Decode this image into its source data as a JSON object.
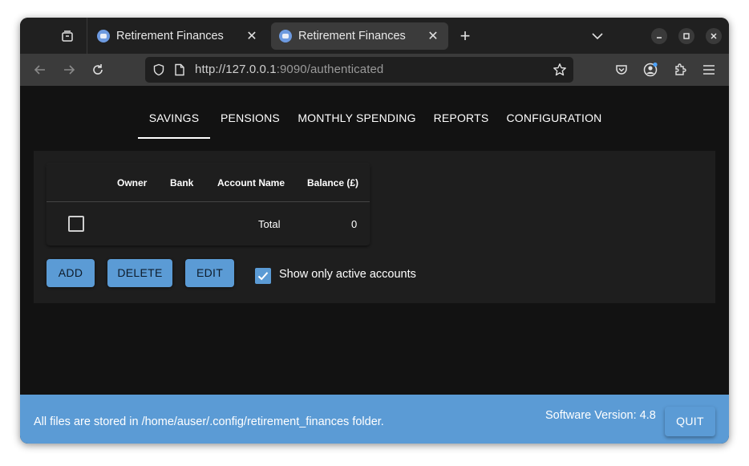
{
  "browser": {
    "tabs": [
      {
        "title": "Retirement Finances",
        "active": false
      },
      {
        "title": "Retirement Finances",
        "active": true
      }
    ],
    "url_host": "http://127.0.0.1",
    "url_rest": ":9090/authenticated"
  },
  "app": {
    "nav_tabs": [
      "SAVINGS",
      "PENSIONS",
      "MONTHLY SPENDING",
      "REPORTS",
      "CONFIGURATION"
    ],
    "selected_tab": "SAVINGS",
    "table": {
      "headers": [
        "Owner",
        "Bank",
        "Account Name",
        "Balance (£)"
      ],
      "total_label": "Total",
      "total_value": "0"
    },
    "buttons": {
      "add": "ADD",
      "delete": "DELETE",
      "edit": "EDIT"
    },
    "show_active_label": "Show only active accounts",
    "show_active_checked": true
  },
  "footer": {
    "storage_text": "All files are stored in /home/auser/.config/retirement_finances folder.",
    "version_text": "Software Version: 4.8",
    "quit_label": "QUIT"
  },
  "colors": {
    "accent": "#5b9bd5",
    "background": "#121212",
    "panel": "#1e1e1e"
  }
}
